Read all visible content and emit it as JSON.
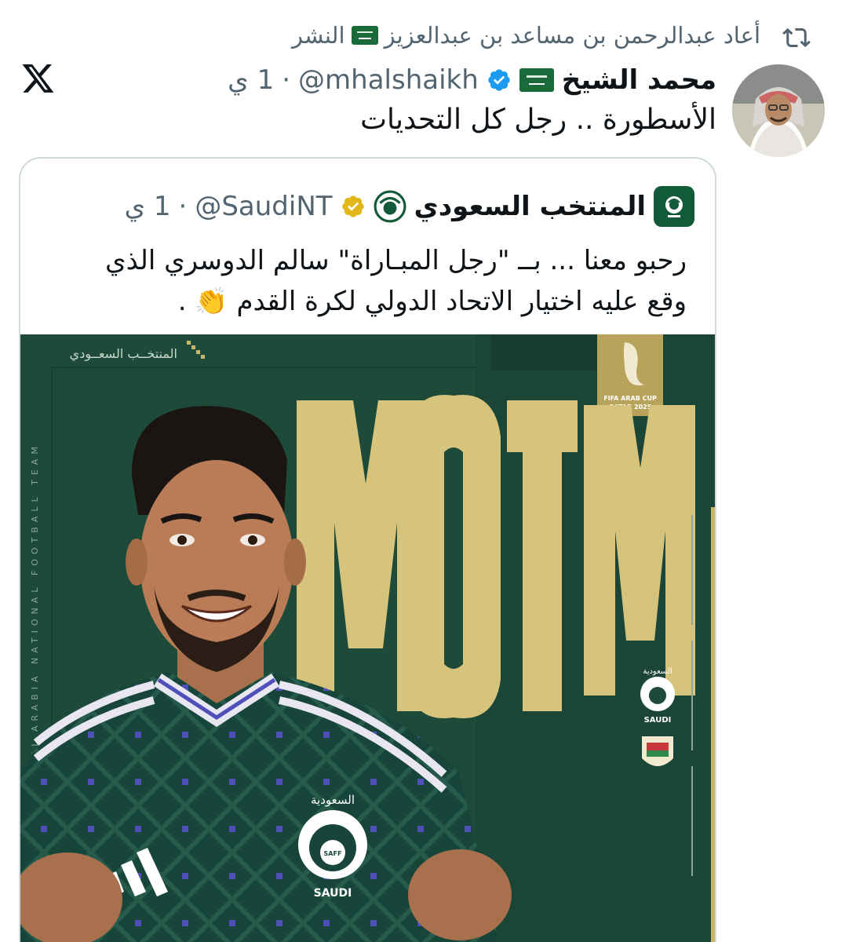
{
  "repost": {
    "text": "أعاد عبدالرحمن بن مساعد بن عبدالعزيز",
    "text_suffix": "النشر",
    "icon": "repost-icon"
  },
  "tweet": {
    "author_name": "محمد الشيخ",
    "handle": "@mhalshaikh",
    "time": "1 ي",
    "separator": "·",
    "text": "الأسطورة .. رجل كل التحديات"
  },
  "quote": {
    "author_name": "المنتخب السعودي",
    "handle": "@SaudiNT",
    "time": "1 ي",
    "separator": "·",
    "text_lines": [
      "رحبو معنا ... بــ \"رجل المبـاراة\" سالم الدوسري الذي",
      "وقع عليه اختيار الاتحاد الدولي لكرة القدم 👏 ."
    ]
  },
  "media": {
    "team_wordmark": "المنتخــب السعــودي",
    "motm": "MOTM",
    "tournament_line1": "FIFA ARAB CUP",
    "tournament_line2": "QATAR 2025",
    "vertical_text": "SAUDI ARABIA NATIONAL FOOTBALL TEAM",
    "badge_top": "السعودية",
    "badge_bottom": "SAUDI",
    "jersey_top": "السعودية",
    "jersey_badge": "SAFF",
    "jersey_bottom": "SAUDI",
    "small_logo_text": "SAFF"
  },
  "colors": {
    "text_primary": "#0f1419",
    "text_secondary": "#536471",
    "verified_blue": "#1d9bf0",
    "verified_gold": "#e2b719",
    "media_green": "#1e4a3a",
    "motm_gold": "#d7c47c",
    "border": "#cfd9de"
  }
}
